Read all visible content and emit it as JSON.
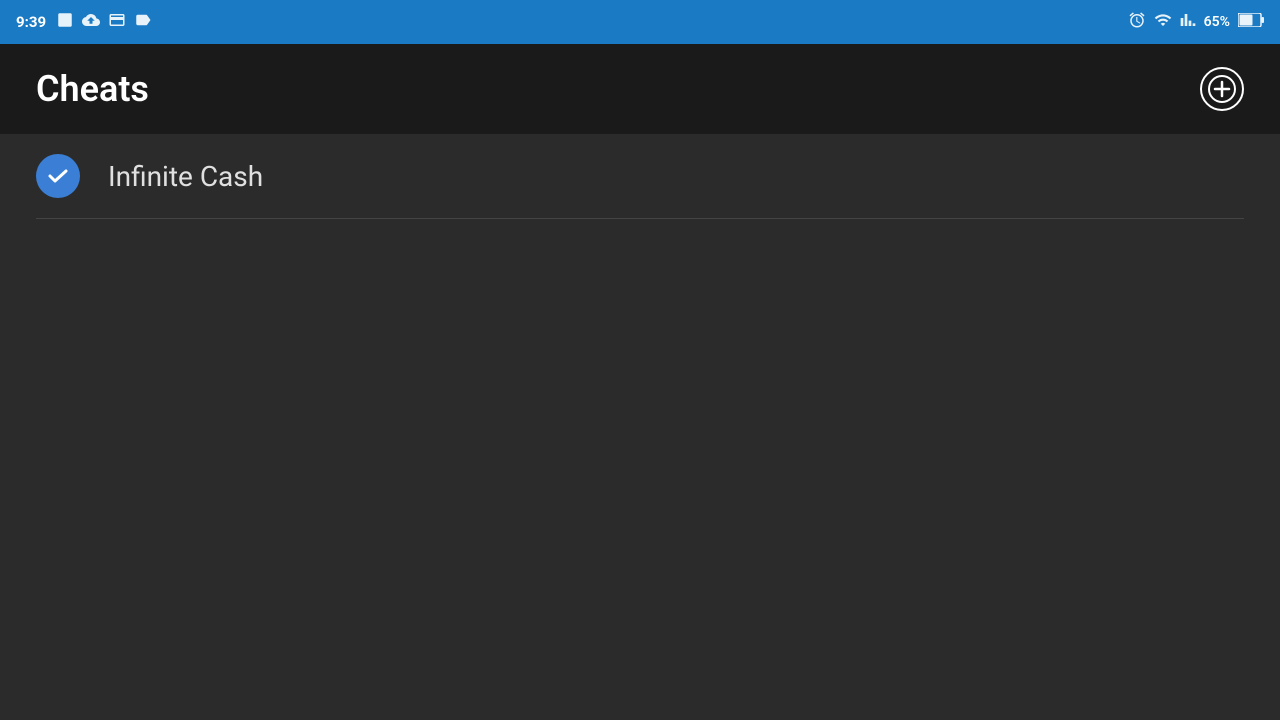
{
  "status_bar": {
    "time": "9:39",
    "battery_percent": "65%",
    "icons": {
      "alarm": "alarm-icon",
      "photo": "photo-icon",
      "upload": "upload-icon",
      "card": "card-icon",
      "tag": "tag-icon",
      "wifi": "wifi-icon",
      "signal": "signal-icon",
      "battery": "battery-icon"
    }
  },
  "title_bar": {
    "title": "Cheats",
    "add_button_label": "+"
  },
  "cheats_list": {
    "items": [
      {
        "label": "Infinite Cash",
        "enabled": true
      }
    ]
  }
}
